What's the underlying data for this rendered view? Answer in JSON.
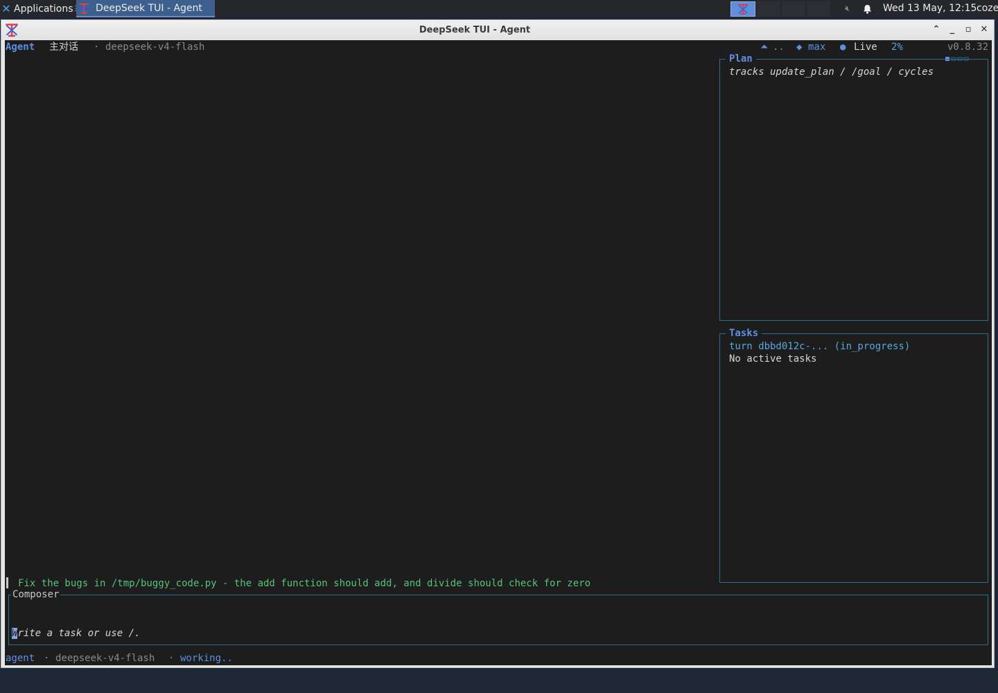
{
  "taskbar": {
    "apps_label": "Applications",
    "apps_sep": "☰",
    "active_task": "DeepSeek TUI - Agent",
    "clock": "Wed 13 May, 12:15",
    "user": "coze"
  },
  "window": {
    "title": "DeepSeek TUI - Agent"
  },
  "header": {
    "mode": "Agent",
    "session": "主对话",
    "sep": "·",
    "model": "deepseek-v4-flash",
    "spinner": "..",
    "effort_icon": "◆",
    "effort": "max",
    "live_icon": "●",
    "live": "Live",
    "context_pct": "2%",
    "context_fraction": 0.02,
    "version": "v0.8.32"
  },
  "plan": {
    "title": "Plan",
    "text": "tracks update_plan / /goal / cycles"
  },
  "tasks": {
    "title": "Tasks",
    "items": [
      "turn dbbd012c-... (in_progress)",
      "No active tasks"
    ]
  },
  "chat": {
    "user_message": "Fix the bugs in /tmp/buggy_code.py - the add function should add, and divide should check for zero"
  },
  "composer": {
    "title": "Composer",
    "placeholder_first": "W",
    "placeholder_rest": "rite a task or use /."
  },
  "statusbar": {
    "mode": "agent",
    "sep": "·",
    "model": "deepseek-v4-flash",
    "state": "working.."
  },
  "colors": {
    "accent": "#5d8fe6",
    "border": "#2c6f8c",
    "user_text": "#58c17a",
    "terminal_bg": "#1d1d1d"
  }
}
